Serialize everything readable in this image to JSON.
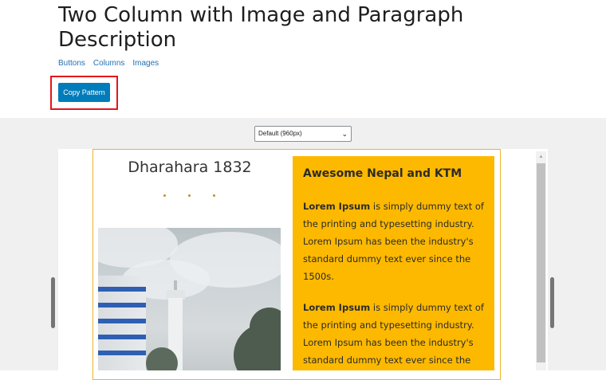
{
  "header": {
    "title": "Two Column with Image and Paragraph Description",
    "tags": [
      "Buttons",
      "Columns",
      "Images"
    ],
    "copy_label": "Copy Pattern"
  },
  "preview": {
    "viewport_selected": "Default (960px)"
  },
  "pattern": {
    "left_title": "Dharahara 1832",
    "right_heading": "Awesome Nepal and KTM",
    "paragraphs": [
      {
        "bold": "Lorem Ipsum",
        "text": " is simply dummy text of the printing and typesetting industry. Lorem Ipsum has been the industry's standard dummy text ever since the 1500s."
      },
      {
        "bold": "Lorem Ipsum",
        "text": " is simply dummy text of the printing and typesetting industry. Lorem Ipsum has been the industry's standard dummy text ever since the"
      }
    ]
  },
  "colors": {
    "accent_button": "#007cba",
    "highlight_outline": "#e4141b",
    "right_column_bg": "#fdb900",
    "preview_bg": "#f0f0f1"
  },
  "icons": {
    "select_chevron": "chevron-down-icon",
    "scroll_up": "arrow-up-icon"
  }
}
